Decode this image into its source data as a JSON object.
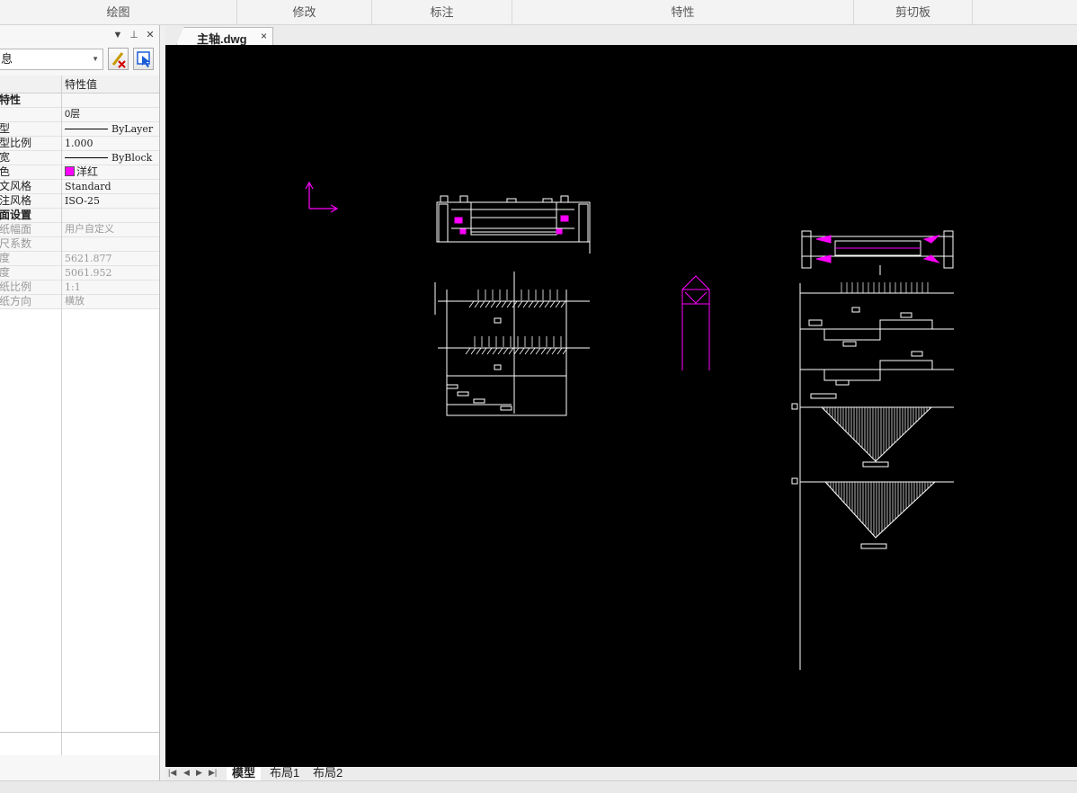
{
  "ribbon": {
    "groups": [
      "绘图",
      "修改",
      "标注",
      "特性",
      "剪切板"
    ]
  },
  "palette": {
    "selector_value": "息",
    "header": {
      "name": "",
      "value": "特性值"
    },
    "rows": [
      {
        "k": "特性",
        "v": "",
        "type": "cat",
        "name": "category-general"
      },
      {
        "k": "",
        "v": "0层",
        "type": "normal",
        "name": "prop-layer"
      },
      {
        "k": "型",
        "v": "ByLayer",
        "type": "line",
        "name": "prop-linetype"
      },
      {
        "k": "型比例",
        "v": "1.000",
        "type": "normal",
        "name": "prop-linetype-scale"
      },
      {
        "k": "宽",
        "v": "ByBlock",
        "type": "line",
        "name": "prop-lineweight"
      },
      {
        "k": "色",
        "v": "洋红",
        "type": "color",
        "name": "prop-color"
      },
      {
        "k": "文风格",
        "v": "Standard",
        "type": "normal",
        "name": "prop-text-style"
      },
      {
        "k": "注风格",
        "v": "ISO-25",
        "type": "normal",
        "name": "prop-dim-style"
      },
      {
        "k": "面设置",
        "v": "",
        "type": "cat",
        "name": "category-layout"
      },
      {
        "k": "纸幅面",
        "v": "用户自定义",
        "type": "dim",
        "name": "prop-paper-size"
      },
      {
        "k": "尺系数",
        "v": "",
        "type": "dim",
        "name": "prop-scale-factor"
      },
      {
        "k": "度",
        "v": "5621.877",
        "type": "dim",
        "name": "prop-width"
      },
      {
        "k": "度",
        "v": "5061.952",
        "type": "dim",
        "name": "prop-height"
      },
      {
        "k": "纸比例",
        "v": "1:1",
        "type": "dim",
        "name": "prop-paper-scale"
      },
      {
        "k": "纸方向",
        "v": "横放",
        "type": "dim",
        "name": "prop-orientation"
      }
    ]
  },
  "document": {
    "tab_title": "主轴.dwg",
    "close_glyph": "×"
  },
  "layout_tabs": [
    "模型",
    "布局1",
    "布局2"
  ],
  "colors": {
    "canvas": "#000000",
    "drawing": "#ffffff",
    "accent": "#ff00ff"
  }
}
